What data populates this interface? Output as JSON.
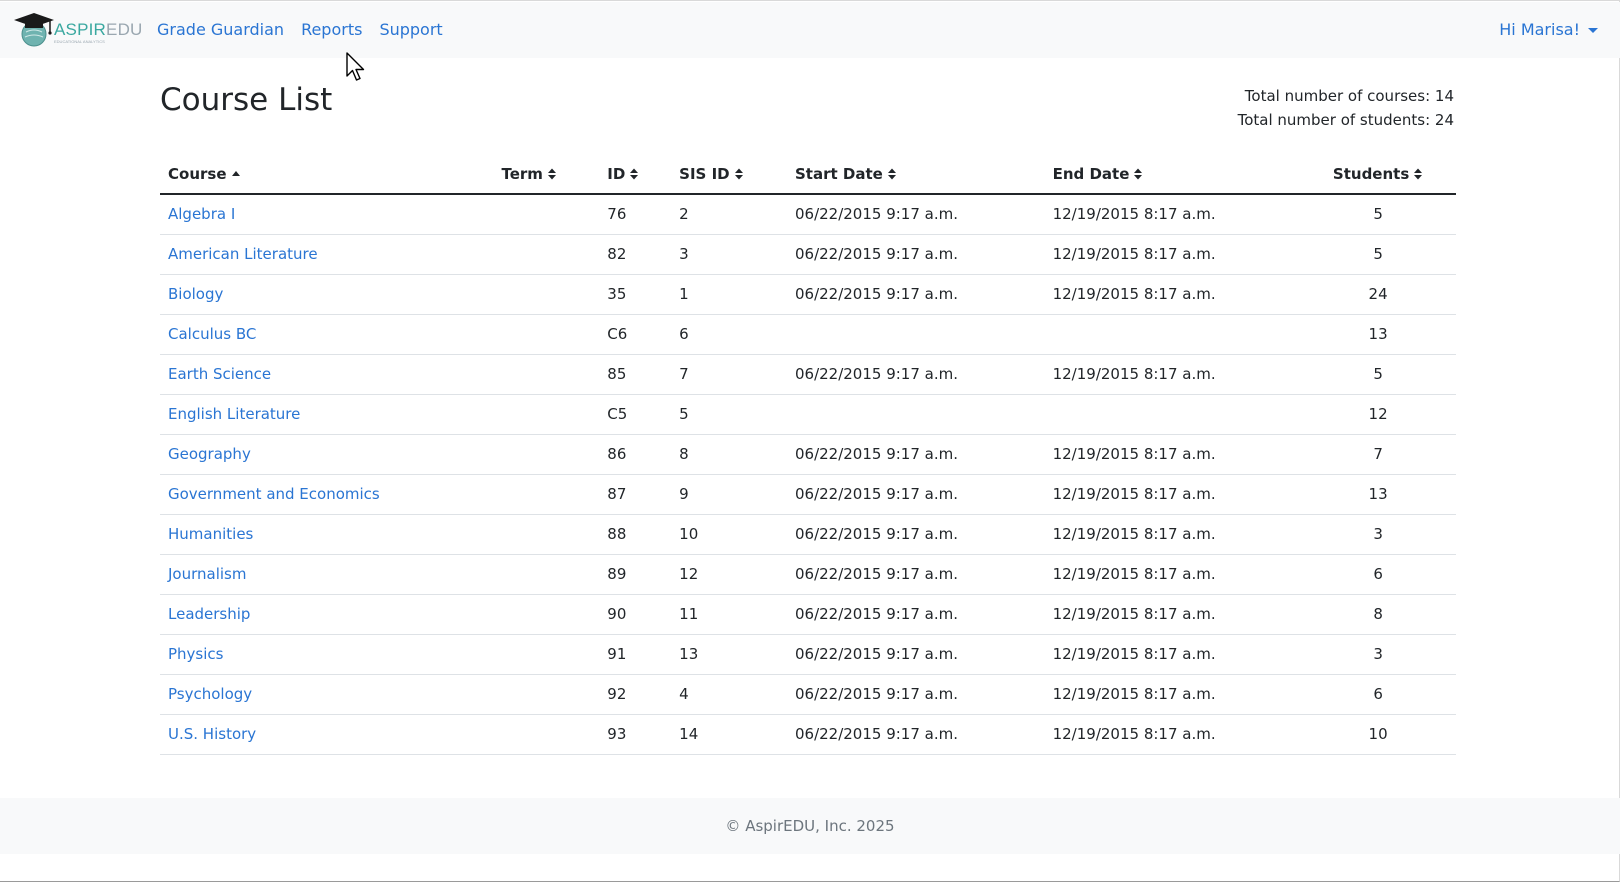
{
  "brand": {
    "name_part1": "ASPIR",
    "name_part2": "EDU",
    "tagline": "EDUCATIONAL ANALYTICS"
  },
  "nav": {
    "links": [
      "Grade Guardian",
      "Reports",
      "Support"
    ],
    "user_label": "Hi Marisa!"
  },
  "page": {
    "title": "Course List",
    "total_courses": "Total number of courses: 14",
    "total_students": "Total number of students: 24"
  },
  "table": {
    "headers": [
      "Course",
      "Term",
      "ID",
      "SIS ID",
      "Start Date",
      "End Date",
      "Students"
    ],
    "sorted_column": "Course",
    "sort_direction": "asc",
    "rows": [
      {
        "course": "Algebra I",
        "term": "",
        "id": "76",
        "sis_id": "2",
        "start": "06/22/2015 9:17 a.m.",
        "end": "12/19/2015 8:17 a.m.",
        "students": "5"
      },
      {
        "course": "American Literature",
        "term": "",
        "id": "82",
        "sis_id": "3",
        "start": "06/22/2015 9:17 a.m.",
        "end": "12/19/2015 8:17 a.m.",
        "students": "5"
      },
      {
        "course": "Biology",
        "term": "",
        "id": "35",
        "sis_id": "1",
        "start": "06/22/2015 9:17 a.m.",
        "end": "12/19/2015 8:17 a.m.",
        "students": "24"
      },
      {
        "course": "Calculus BC",
        "term": "",
        "id": "C6",
        "sis_id": "6",
        "start": "",
        "end": "",
        "students": "13"
      },
      {
        "course": "Earth Science",
        "term": "",
        "id": "85",
        "sis_id": "7",
        "start": "06/22/2015 9:17 a.m.",
        "end": "12/19/2015 8:17 a.m.",
        "students": "5"
      },
      {
        "course": "English Literature",
        "term": "",
        "id": "C5",
        "sis_id": "5",
        "start": "",
        "end": "",
        "students": "12"
      },
      {
        "course": "Geography",
        "term": "",
        "id": "86",
        "sis_id": "8",
        "start": "06/22/2015 9:17 a.m.",
        "end": "12/19/2015 8:17 a.m.",
        "students": "7"
      },
      {
        "course": "Government and Economics",
        "term": "",
        "id": "87",
        "sis_id": "9",
        "start": "06/22/2015 9:17 a.m.",
        "end": "12/19/2015 8:17 a.m.",
        "students": "13"
      },
      {
        "course": "Humanities",
        "term": "",
        "id": "88",
        "sis_id": "10",
        "start": "06/22/2015 9:17 a.m.",
        "end": "12/19/2015 8:17 a.m.",
        "students": "3"
      },
      {
        "course": "Journalism",
        "term": "",
        "id": "89",
        "sis_id": "12",
        "start": "06/22/2015 9:17 a.m.",
        "end": "12/19/2015 8:17 a.m.",
        "students": "6"
      },
      {
        "course": "Leadership",
        "term": "",
        "id": "90",
        "sis_id": "11",
        "start": "06/22/2015 9:17 a.m.",
        "end": "12/19/2015 8:17 a.m.",
        "students": "8"
      },
      {
        "course": "Physics",
        "term": "",
        "id": "91",
        "sis_id": "13",
        "start": "06/22/2015 9:17 a.m.",
        "end": "12/19/2015 8:17 a.m.",
        "students": "3"
      },
      {
        "course": "Psychology",
        "term": "",
        "id": "92",
        "sis_id": "4",
        "start": "06/22/2015 9:17 a.m.",
        "end": "12/19/2015 8:17 a.m.",
        "students": "6"
      },
      {
        "course": "U.S. History",
        "term": "",
        "id": "93",
        "sis_id": "14",
        "start": "06/22/2015 9:17 a.m.",
        "end": "12/19/2015 8:17 a.m.",
        "students": "10"
      }
    ]
  },
  "footer": {
    "text": "© AspirEDU, Inc. 2025"
  },
  "colors": {
    "link": "#2a75d3",
    "brand_teal": "#3aa8a0",
    "navbar_bg": "#f8f9fa"
  }
}
